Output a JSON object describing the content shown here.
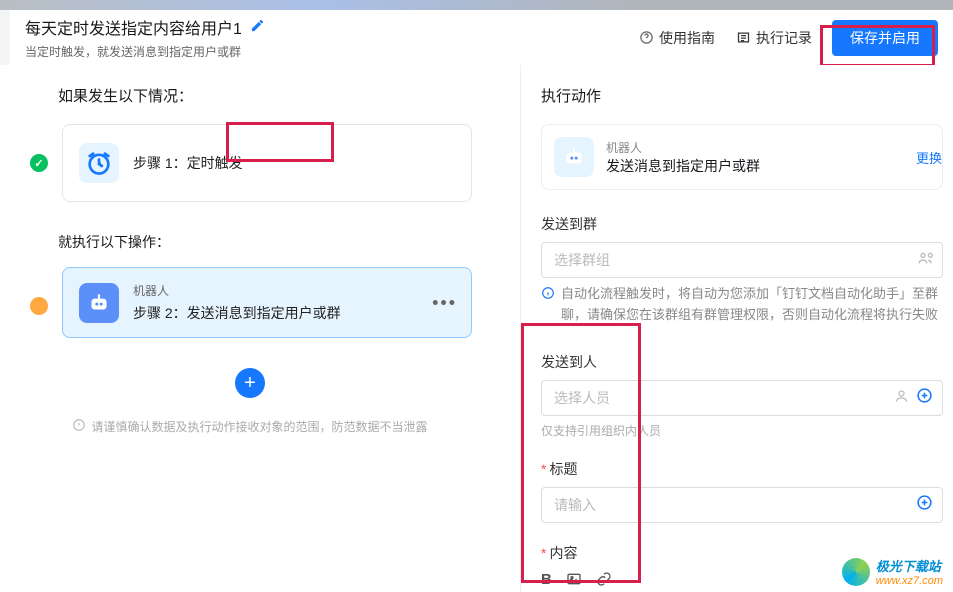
{
  "header": {
    "title": "每天定时发送指定内容给用户1",
    "subtitle": "当定时触发，就发送消息到指定用户或群",
    "guide_label": "使用指南",
    "records_label": "执行记录",
    "save_label": "保存并启用"
  },
  "left": {
    "condition_heading": "如果发生以下情况：",
    "action_heading": "就执行以下操作：",
    "step1": {
      "label": "步骤 1：",
      "trigger": "定时触发"
    },
    "step2": {
      "sub": "机器人",
      "main": "步骤 2：发送消息到指定用户或群"
    },
    "disclaimer": "请谨慎确认数据及执行动作接收对象的范围，防范数据不当泄露"
  },
  "right": {
    "action_heading": "执行动作",
    "card": {
      "sub": "机器人",
      "main": "发送消息到指定用户或群",
      "link": "更换"
    },
    "group_label": "发送到群",
    "group_placeholder": "选择群组",
    "group_info": "自动化流程触发时，将自动为您添加「钉钉文档自动化助手」至群聊，请确保您在该群组有群管理权限，否则自动化流程将执行失败",
    "person_label": "发送到人",
    "person_placeholder": "选择人员",
    "person_hint": "仅支持引用组织内人员",
    "title_label": "标题",
    "title_placeholder": "请输入",
    "content_label": "内容"
  },
  "watermark": {
    "t1": "极光下载站",
    "t2": "www.xz7.com"
  }
}
